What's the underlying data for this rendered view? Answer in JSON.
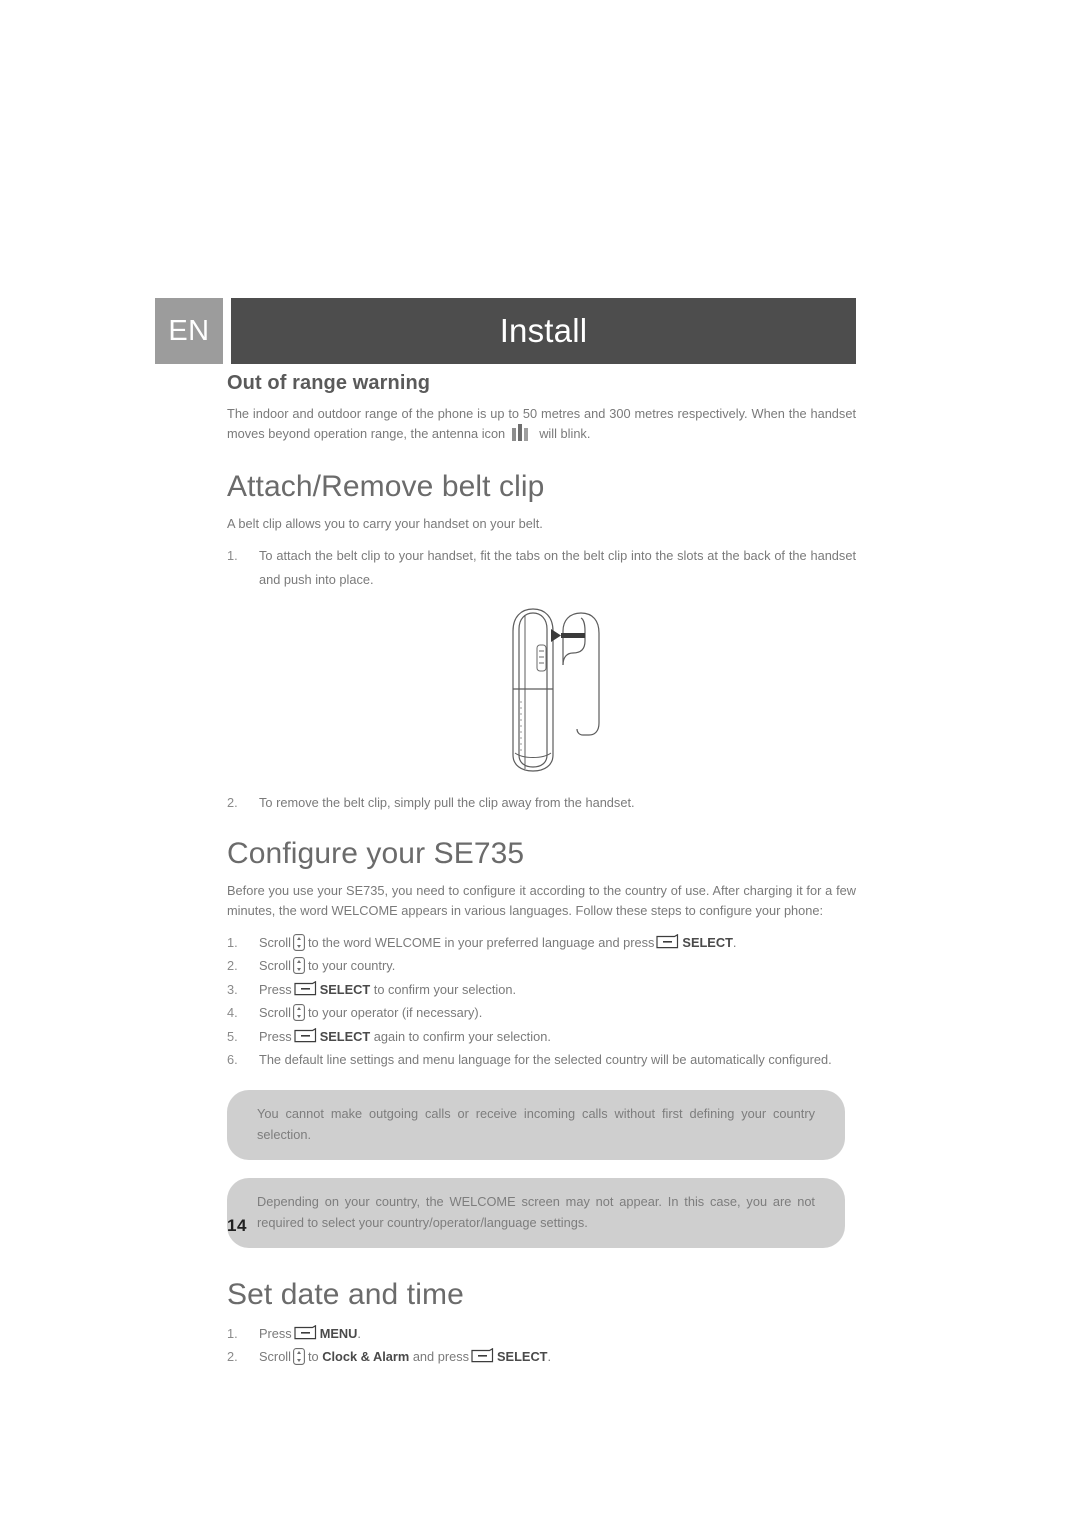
{
  "header": {
    "language_code": "EN",
    "title": "Install",
    "lang_box_color": "#9c9c9c",
    "title_band_color": "#4d4d4d"
  },
  "out_of_range": {
    "heading": "Out of range warning",
    "paragraph_part1": "The indoor and outdoor range of the phone is up to 50 metres and 300 metres respectively. When the handset moves beyond operation range, the antenna icon",
    "paragraph_part2": "will blink.",
    "antenna_icon_name": "antenna-signal-icon"
  },
  "belt_clip": {
    "heading": "Attach/Remove belt clip",
    "intro": "A belt clip allows you to carry your handset on your belt.",
    "steps": [
      {
        "num": "1.",
        "text": "To attach the belt clip to your handset, fit the tabs on the belt clip into the slots at the back of the handset and push into place."
      },
      {
        "num": "2.",
        "text": "To remove the belt clip, simply pull the clip away from the handset."
      }
    ],
    "illustration_caption": "handset-with-belt-clip-diagram"
  },
  "configure": {
    "heading": "Configure your SE735",
    "intro": "Before you use your SE735, you need to configure it according to the country of use. After charging it for a few minutes, the word WELCOME appears in various languages. Follow these steps to configure your phone:",
    "steps": [
      {
        "num": "1.",
        "pre": "Scroll",
        "icon": "scroll-key-icon",
        "mid": "to the word WELCOME in your preferred language and press",
        "icon2": "select-key-icon",
        "bold": "SELECT",
        "post": "."
      },
      {
        "num": "2.",
        "pre": "Scroll",
        "icon": "scroll-key-icon",
        "mid": "to your country.",
        "icon2": "",
        "bold": "",
        "post": ""
      },
      {
        "num": "3.",
        "pre": "Press",
        "icon": "",
        "mid": "",
        "icon2": "select-key-icon",
        "bold": "SELECT",
        "post": " to confirm your selection."
      },
      {
        "num": "4.",
        "pre": "Scroll",
        "icon": "scroll-key-icon",
        "mid": "to your operator (if necessary).",
        "icon2": "",
        "bold": "",
        "post": ""
      },
      {
        "num": "5.",
        "pre": "Press",
        "icon": "",
        "mid": "",
        "icon2": "select-key-icon",
        "bold": "SELECT",
        "post": " again to confirm your selection."
      },
      {
        "num": "6.",
        "pre": "The default line settings and menu language for the selected country will be automatically configured.",
        "icon": "",
        "mid": "",
        "icon2": "",
        "bold": "",
        "post": ""
      }
    ],
    "notes": [
      "You cannot make outgoing calls or receive incoming calls without first defining your country selection.",
      "Depending on your country, the WELCOME screen may not appear. In this case, you are not required to select your country/operator/language settings."
    ],
    "note_background": "#cfcfcf"
  },
  "set_date_time": {
    "heading": "Set date and time",
    "steps": [
      {
        "num": "1.",
        "pre": "Press",
        "icon2": "select-key-icon",
        "bold": "MENU",
        "post": "."
      },
      {
        "num": "2.",
        "pre": "Scroll",
        "icon": "scroll-key-icon",
        "mid": "to",
        "bold_mid": "Clock & Alarm",
        "mid2": "and press",
        "icon2": "select-key-icon",
        "bold": "SELECT",
        "post": "."
      }
    ]
  },
  "footer": {
    "page_number": "14"
  }
}
